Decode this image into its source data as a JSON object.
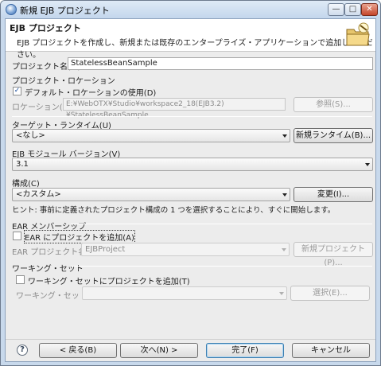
{
  "window": {
    "title": "新規 EJB プロジェクト",
    "minimize_glyph": "—",
    "maximize_glyph": "□",
    "close_glyph": "✕"
  },
  "banner": {
    "title": "EJB プロジェクト",
    "description": "EJB プロジェクトを作成し、新規または既存のエンタープライズ・アプリケーションで追加してください。",
    "icon": "folder-wizard-icon"
  },
  "project_name": {
    "label": "プロジェクト名(M):",
    "value": "StatelessBeanSample"
  },
  "project_location": {
    "section_label": "プロジェクト・ロケーション",
    "default_checkbox_label": "デフォルト・ロケーションの使用(D)",
    "default_checked": true,
    "location_label": "ロケーション(L):",
    "location_value": "E:¥WebOTX¥Studio¥workspace2_18(EJB3.2)¥StatelessBeanSample",
    "browse_button": "参照(S)..."
  },
  "target_runtime": {
    "label": "ターゲット・ランタイム(U)",
    "selected": "<なし>",
    "new_button": "新規ランタイム(B)..."
  },
  "ejb_module_version": {
    "label": "EJB モジュール バージョン(V)",
    "selected": "3.1"
  },
  "configuration": {
    "label": "構成(C)",
    "selected": "<カスタム>",
    "modify_button": "変更(I)...",
    "hint": "ヒント: 事前に定義されたプロジェクト構成の 1 つを選択することにより、すぐに開始します。"
  },
  "ear_membership": {
    "section_label": "EAR メンバーシップ",
    "checkbox_label": "EAR にプロジェクトを追加(A)",
    "checked": false,
    "ear_project_label": "EAR プロジェクト名(E):",
    "ear_project_value": "EJBProject",
    "new_project_button": "新規プロジェクト(P)..."
  },
  "working_set": {
    "section_label": "ワーキング・セット",
    "checkbox_label": "ワーキング・セットにプロジェクトを追加(T)",
    "checked": false,
    "working_set_label": "ワーキング・セット(O):",
    "working_set_value": "",
    "select_button": "選択(E)..."
  },
  "footer": {
    "help_glyph": "?",
    "back_button": "< 戻る(B)",
    "next_button": "次へ(N) >",
    "finish_button": "完了(F)",
    "cancel_button": "キャンセル"
  },
  "colors": {
    "title_bar": "#c3d6ec",
    "dialog_bg": "#ececec",
    "banner_bg": "#ffffff",
    "accent": "#3c7fb1"
  }
}
